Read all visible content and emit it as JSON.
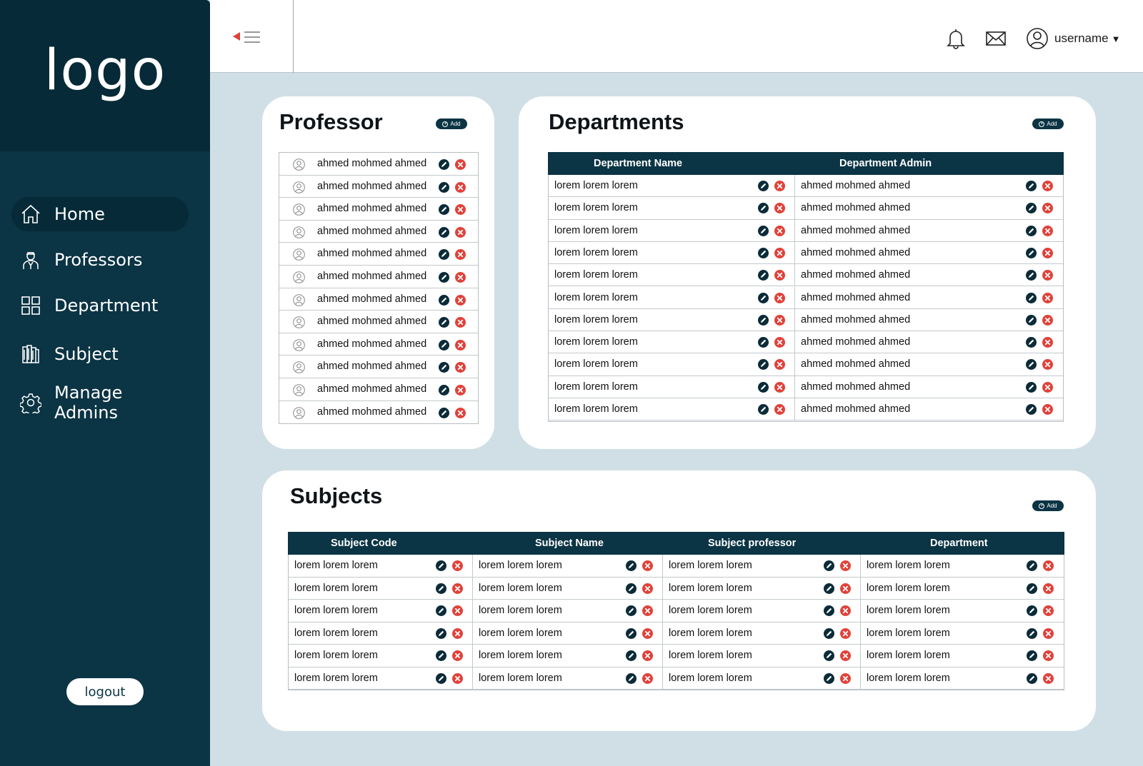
{
  "sidebar": {
    "logo": "logo",
    "items": [
      {
        "label": "Home",
        "icon": "home-icon",
        "active": true
      },
      {
        "label": "Professors",
        "icon": "professor-icon"
      },
      {
        "label": "Department",
        "icon": "grid-icon"
      },
      {
        "label": "Subject",
        "icon": "books-icon"
      },
      {
        "label": "Manage Admins",
        "icon": "gear-icon"
      }
    ],
    "logout": "logout"
  },
  "topbar": {
    "username": "username",
    "icons": [
      "menu-toggle-icon",
      "bell-icon",
      "mail-icon",
      "user-icon"
    ]
  },
  "colors": {
    "sidebar": "#0b3444",
    "logo_bg": "#062a37",
    "page_bg": "#cfdfe5",
    "header": "#0b3444",
    "delete": "#e0423a",
    "edit": "#0b2b38",
    "toggle_arrow": "#e0423a"
  },
  "professor": {
    "title": "Professor",
    "add": "Add",
    "rows": [
      "ahmed mohmed ahmed",
      "ahmed mohmed ahmed",
      "ahmed mohmed ahmed",
      "ahmed mohmed ahmed",
      "ahmed mohmed ahmed",
      "ahmed mohmed ahmed",
      "ahmed mohmed ahmed",
      "ahmed mohmed ahmed",
      "ahmed mohmed ahmed",
      "ahmed mohmed ahmed",
      "ahmed mohmed ahmed",
      "ahmed mohmed ahmed"
    ]
  },
  "departments": {
    "title": "Departments",
    "add": "Add",
    "columns": [
      "Department Name",
      "Department Admin"
    ],
    "rows": [
      [
        "lorem lorem lorem",
        "ahmed mohmed ahmed"
      ],
      [
        "lorem lorem lorem",
        "ahmed mohmed ahmed"
      ],
      [
        "lorem lorem lorem",
        "ahmed mohmed ahmed"
      ],
      [
        "lorem lorem lorem",
        "ahmed mohmed ahmed"
      ],
      [
        "lorem lorem lorem",
        "ahmed mohmed ahmed"
      ],
      [
        "lorem lorem lorem",
        "ahmed mohmed ahmed"
      ],
      [
        "lorem lorem lorem",
        "ahmed mohmed ahmed"
      ],
      [
        "lorem lorem lorem",
        "ahmed mohmed ahmed"
      ],
      [
        "lorem lorem lorem",
        "ahmed mohmed ahmed"
      ],
      [
        "lorem lorem lorem",
        "ahmed mohmed ahmed"
      ],
      [
        "lorem lorem lorem",
        "ahmed mohmed ahmed"
      ]
    ]
  },
  "subjects": {
    "title": "Subjects",
    "add": "Add",
    "columns": [
      "Subject Code",
      "Subject Name",
      "Subject professor",
      "Department"
    ],
    "rows": [
      [
        "lorem lorem lorem",
        "lorem lorem lorem",
        "lorem lorem lorem",
        "lorem lorem lorem"
      ],
      [
        "lorem lorem lorem",
        "lorem lorem lorem",
        "lorem lorem lorem",
        "lorem lorem lorem"
      ],
      [
        "lorem lorem lorem",
        "lorem lorem lorem",
        "lorem lorem lorem",
        "lorem lorem lorem"
      ],
      [
        "lorem lorem lorem",
        "lorem lorem lorem",
        "lorem lorem lorem",
        "lorem lorem lorem"
      ],
      [
        "lorem lorem lorem",
        "lorem lorem lorem",
        "lorem lorem lorem",
        "lorem lorem lorem"
      ],
      [
        "lorem lorem lorem",
        "lorem lorem lorem",
        "lorem lorem lorem",
        "lorem lorem lorem"
      ]
    ]
  }
}
